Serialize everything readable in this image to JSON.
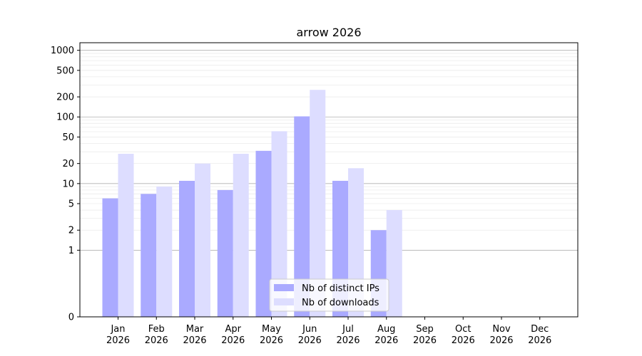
{
  "chart_data": {
    "type": "bar",
    "title": "arrow 2026",
    "xlabel": "",
    "ylabel": "",
    "categories": [
      [
        "Jan",
        "2026"
      ],
      [
        "Feb",
        "2026"
      ],
      [
        "Mar",
        "2026"
      ],
      [
        "Apr",
        "2026"
      ],
      [
        "May",
        "2026"
      ],
      [
        "Jun",
        "2026"
      ],
      [
        "Jul",
        "2026"
      ],
      [
        "Aug",
        "2026"
      ],
      [
        "Sep",
        "2026"
      ],
      [
        "Oct",
        "2026"
      ],
      [
        "Nov",
        "2026"
      ],
      [
        "Dec",
        "2026"
      ]
    ],
    "series": [
      {
        "name": "Nb of distinct IPs",
        "color": "#aaaaff",
        "values": [
          6,
          7,
          11,
          8,
          31,
          102,
          11,
          2,
          0,
          0,
          0,
          0
        ]
      },
      {
        "name": "Nb of downloads",
        "color": "#ddddff",
        "values": [
          28,
          9,
          20,
          28,
          61,
          255,
          17,
          4,
          0,
          0,
          0,
          0
        ]
      }
    ],
    "y_scale": "symlog",
    "ylim": [
      0,
      1300
    ],
    "y_ticks": [
      0,
      1,
      2,
      5,
      10,
      20,
      50,
      100,
      200,
      500,
      1000
    ],
    "y_tick_labels": [
      "0",
      "1",
      "2",
      "5",
      "10",
      "20",
      "50",
      "100",
      "200",
      "500",
      "1000"
    ],
    "grid": true,
    "legend_position": "bottom-center"
  }
}
